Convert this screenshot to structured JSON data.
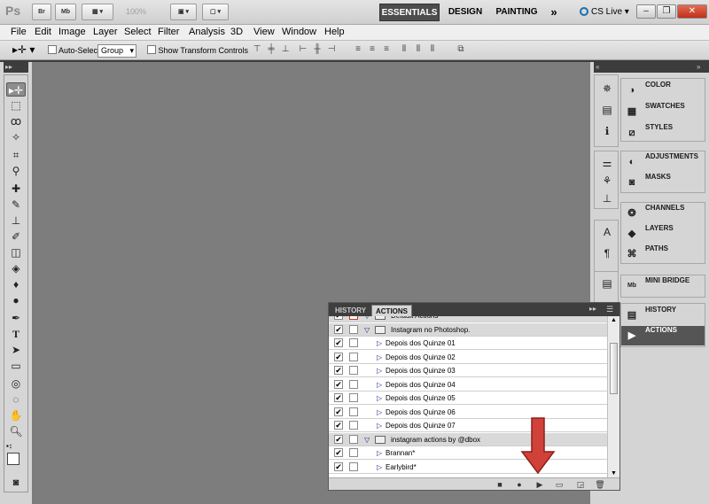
{
  "app": {
    "logo": "Ps",
    "bridge_btn": "Br",
    "minibridge_btn": "Mb",
    "zoom_level": "100%",
    "workspaces": [
      "ESSENTIALS",
      "DESIGN",
      "PAINTING"
    ],
    "more_workspaces": "»",
    "cs_live": "CS Live",
    "window_buttons": {
      "minimize": "–",
      "restore": "❐",
      "close": "✕"
    }
  },
  "menu": [
    "File",
    "Edit",
    "Image",
    "Layer",
    "Select",
    "Filter",
    "Analysis",
    "3D",
    "View",
    "Window",
    "Help"
  ],
  "options": {
    "auto_select_label": "Auto-Select:",
    "auto_select_value": "Group",
    "show_transform_label": "Show Transform Controls"
  },
  "dock": {
    "groups": [
      [
        {
          "icon": "color-icon",
          "label": "COLOR"
        },
        {
          "icon": "swatches-icon",
          "label": "SWATCHES"
        },
        {
          "icon": "styles-icon",
          "label": "STYLES"
        }
      ],
      [
        {
          "icon": "adjustments-icon",
          "label": "ADJUSTMENTS"
        },
        {
          "icon": "masks-icon",
          "label": "MASKS"
        }
      ],
      [
        {
          "icon": "channels-icon",
          "label": "CHANNELS"
        },
        {
          "icon": "layers-icon",
          "label": "LAYERS"
        },
        {
          "icon": "paths-icon",
          "label": "PATHS"
        }
      ],
      [
        {
          "icon": "mini-bridge-icon",
          "label": "MINI BRIDGE"
        }
      ],
      [
        {
          "icon": "history-icon",
          "label": "HISTORY"
        },
        {
          "icon": "actions-icon",
          "label": "ACTIONS",
          "active": true
        }
      ]
    ]
  },
  "panel": {
    "tabs": [
      "HISTORY",
      "ACTIONS"
    ],
    "active_tab": "ACTIONS",
    "rows": [
      {
        "type": "set",
        "label": "Default Actions",
        "checked": true,
        "partial": true
      },
      {
        "type": "set",
        "label": "Instagram no Photoshop.",
        "checked": true
      },
      {
        "type": "action",
        "label": "Depois dos Quinze 01",
        "checked": true
      },
      {
        "type": "action",
        "label": "Depois dos Quinze 02",
        "checked": true
      },
      {
        "type": "action",
        "label": "Depois dos Quinze 03",
        "checked": true
      },
      {
        "type": "action",
        "label": "Depois dos Quinze 04",
        "checked": true
      },
      {
        "type": "action",
        "label": "Depois dos Quinze 05",
        "checked": true
      },
      {
        "type": "action",
        "label": "Depois dos Quinze 06",
        "checked": true
      },
      {
        "type": "action",
        "label": "Depois dos Quinze 07",
        "checked": true
      },
      {
        "type": "set",
        "label": "instagram actions by @dbox",
        "checked": true
      },
      {
        "type": "action",
        "label": "Brannan*",
        "checked": true
      },
      {
        "type": "action",
        "label": "Earlybird*",
        "checked": true
      }
    ]
  },
  "colors": {
    "canvas": "#7d7d7d",
    "annotation_arrow": "#d0413a"
  }
}
